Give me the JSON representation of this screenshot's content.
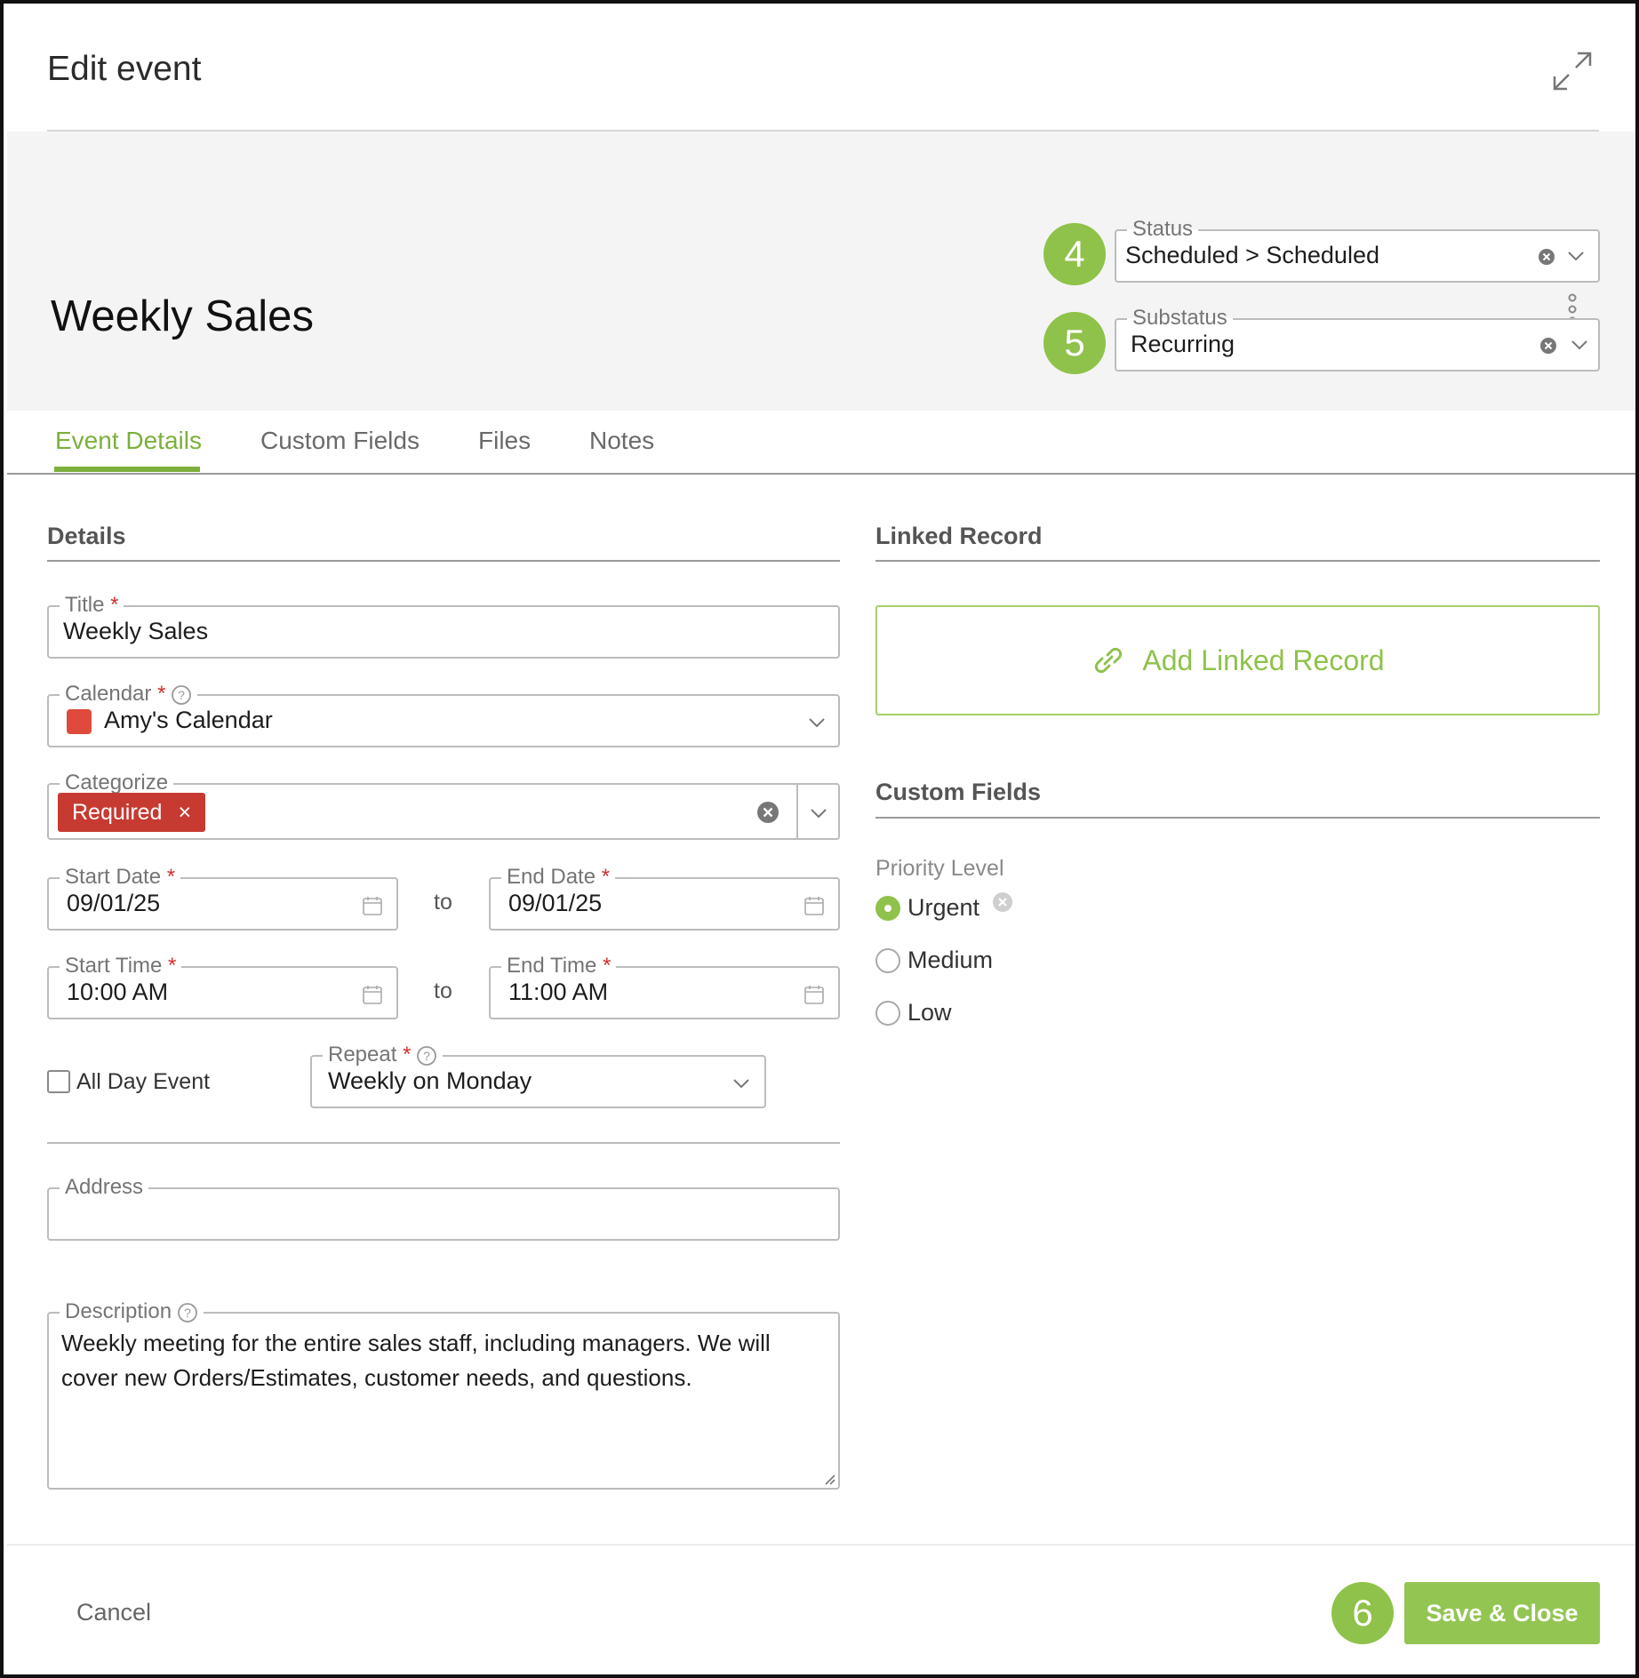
{
  "dialog": {
    "title": "Edit event"
  },
  "event": {
    "title": "Weekly Sales"
  },
  "header": {
    "status": {
      "badge": "4",
      "label": "Status",
      "value": "Scheduled > Scheduled"
    },
    "substatus": {
      "badge": "5",
      "label": "Substatus",
      "value": "Recurring"
    }
  },
  "tabs": [
    {
      "label": "Event Details",
      "active": true
    },
    {
      "label": "Custom Fields",
      "active": false
    },
    {
      "label": "Files",
      "active": false
    },
    {
      "label": "Notes",
      "active": false
    }
  ],
  "details": {
    "section_title": "Details",
    "title_field": {
      "label": "Title",
      "required": "*",
      "value": "Weekly Sales"
    },
    "calendar": {
      "label": "Calendar",
      "required": "*",
      "value": "Amy's Calendar",
      "color": "#e04a3c"
    },
    "categorize": {
      "label": "Categorize",
      "chip": "Required",
      "chip_remove": "×",
      "chip_color": "#c73a32"
    },
    "start_date": {
      "label": "Start Date",
      "required": "*",
      "value": "09/01/25"
    },
    "end_date": {
      "label": "End Date",
      "required": "*",
      "value": "09/01/25"
    },
    "start_time": {
      "label": "Start Time",
      "required": "*",
      "value": "10:00 AM"
    },
    "end_time": {
      "label": "End Time",
      "required": "*",
      "value": "11:00 AM"
    },
    "to_label": "to",
    "all_day": {
      "label": "All Day Event",
      "checked": false
    },
    "repeat": {
      "label": "Repeat",
      "required": "*",
      "value": "Weekly on Monday"
    },
    "address": {
      "label": "Address",
      "value": ""
    },
    "description": {
      "label": "Description",
      "value": "Weekly meeting for the entire sales staff, including managers. We will cover new Orders/Estimates, customer needs, and questions."
    }
  },
  "linked_record": {
    "section_title": "Linked Record",
    "button_label": "Add Linked Record"
  },
  "custom_fields": {
    "section_title": "Custom Fields",
    "priority": {
      "label": "Priority Level",
      "options": [
        {
          "label": "Urgent",
          "selected": true
        },
        {
          "label": "Medium",
          "selected": false
        },
        {
          "label": "Low",
          "selected": false
        }
      ]
    }
  },
  "footer": {
    "cancel_label": "Cancel",
    "save_badge": "6",
    "save_label": "Save & Close"
  },
  "colors": {
    "accent": "#8fc24a",
    "accent_dark": "#7caf3c",
    "required": "#d32f2f",
    "header_bg": "#f4f4f4"
  }
}
